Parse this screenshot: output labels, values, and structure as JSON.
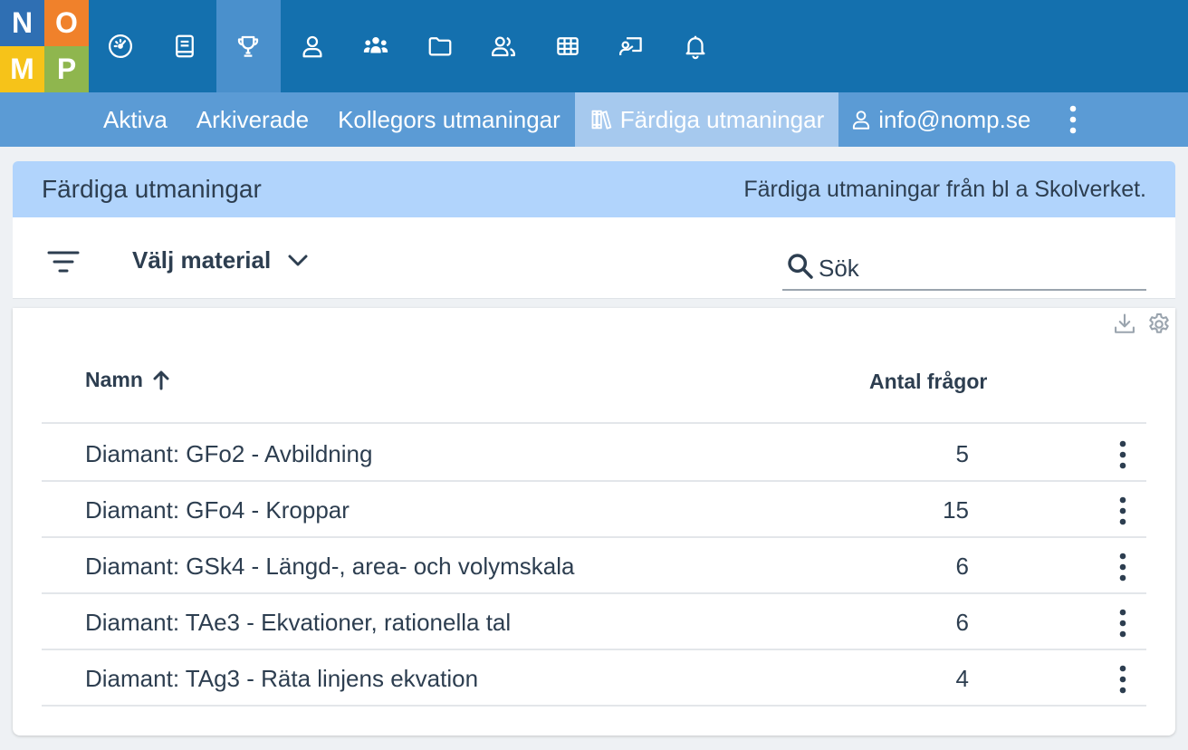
{
  "logo": {
    "letters": [
      "N",
      "O",
      "M",
      "P"
    ]
  },
  "nav": {
    "icons": [
      "dashboard-icon",
      "book-icon",
      "trophy-icon",
      "user-icon",
      "group-icon",
      "folder-icon",
      "users-icon",
      "grid-icon",
      "presentation-icon",
      "bell-icon"
    ],
    "active_index": 2
  },
  "subnav": {
    "tabs": [
      {
        "label": "Aktiva"
      },
      {
        "label": "Arkiverade"
      },
      {
        "label": "Kollegors utmaningar"
      },
      {
        "label": "Färdiga utmaningar",
        "active": true
      }
    ],
    "user_email": "info@nomp.se"
  },
  "banner": {
    "title": "Färdiga utmaningar",
    "description": "Färdiga utmaningar från bl a Skolverket."
  },
  "filters": {
    "material_label": "Välj material",
    "search_placeholder": "Sök"
  },
  "table": {
    "headers": {
      "name": "Namn",
      "count": "Antal frågor"
    },
    "sort": "name-ascending",
    "rows": [
      {
        "name": "Diamant: GFo2 - Avbildning",
        "count": "5"
      },
      {
        "name": "Diamant: GFo4 - Kroppar",
        "count": "15"
      },
      {
        "name": "Diamant: GSk4 - Längd-, area- och volymskala",
        "count": "6"
      },
      {
        "name": "Diamant: TAe3 - Ekvationer, rationella tal",
        "count": "6"
      },
      {
        "name": "Diamant: TAg3 - Räta linjens ekvation",
        "count": "4"
      }
    ]
  },
  "colors": {
    "topbar": "#1470ae",
    "subbar": "#5b9bd5",
    "active_tab": "#a6c9ee",
    "banner": "#b1d4fc",
    "logo_n": "#2f6fb3",
    "logo_o": "#f0812b",
    "logo_m": "#f6c319",
    "logo_p": "#8fb64e"
  }
}
